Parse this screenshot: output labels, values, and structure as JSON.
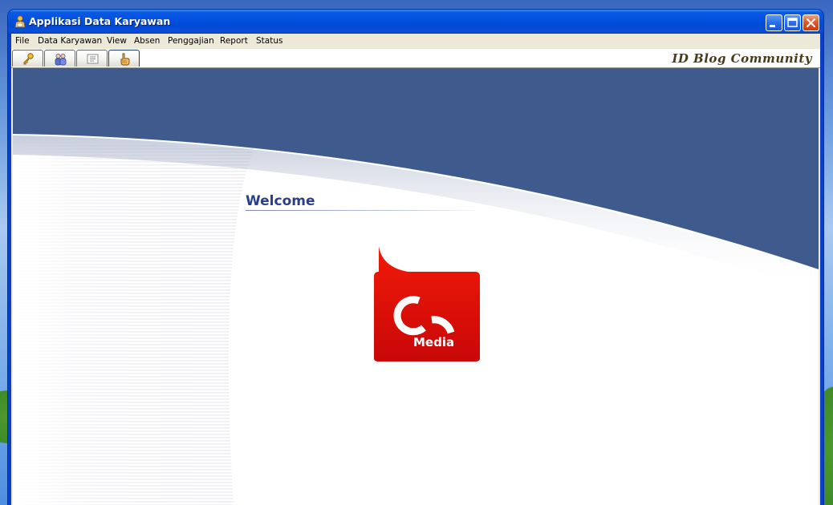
{
  "window": {
    "title": "Applikasi Data Karyawan"
  },
  "menu": {
    "items": [
      "File",
      "Data Karyawan",
      "View",
      "Absen",
      "Penggajian",
      "Report",
      "Status"
    ]
  },
  "toolbar": {
    "tabs": [
      "key-icon",
      "users-icon",
      "list-icon",
      "hand-pointer-icon"
    ],
    "brand": "ID Blog Community"
  },
  "main": {
    "welcome": "Welcome",
    "logo_text": "Media"
  },
  "colors": {
    "header_band": "#3f5b8d",
    "welcome_text": "#2a3f8c",
    "logo_red": "#e8190a"
  }
}
